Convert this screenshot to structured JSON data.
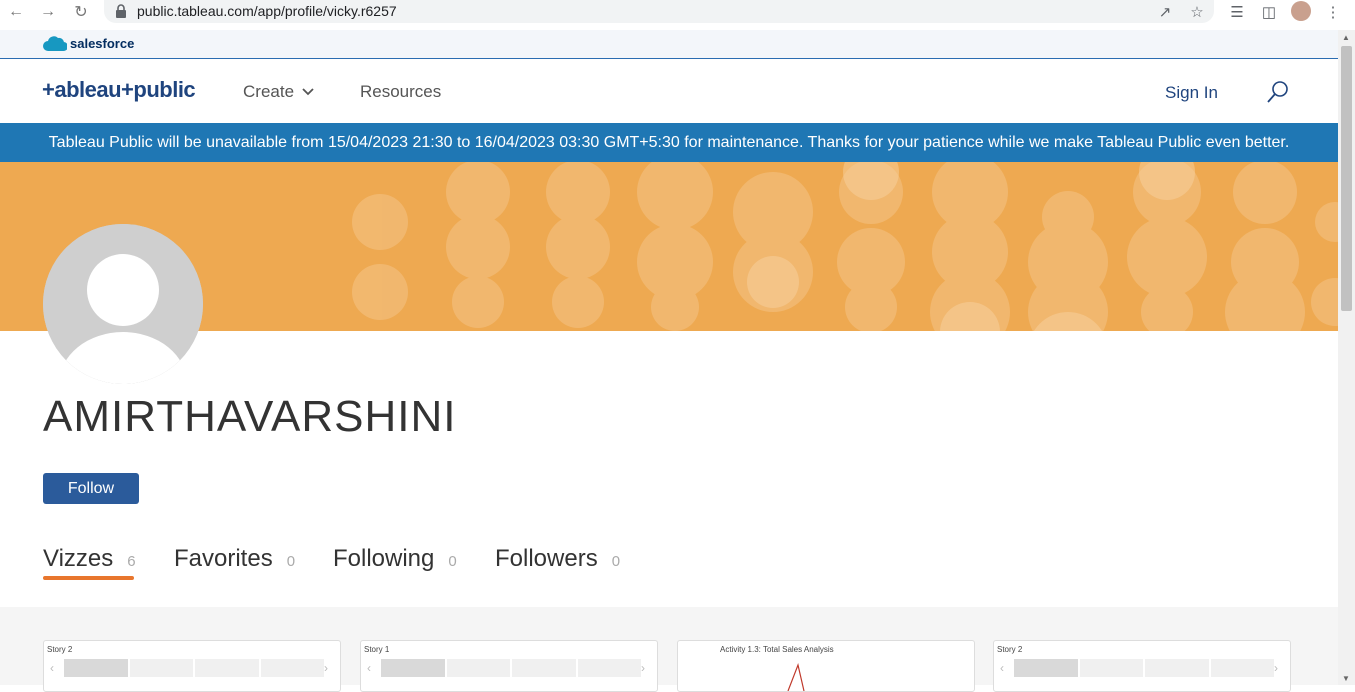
{
  "browser": {
    "url": "public.tableau.com/app/profile/vicky.r6257"
  },
  "salesforce": {
    "label": "salesforce"
  },
  "header": {
    "logo": "+ableau+public",
    "nav": {
      "create": "Create",
      "resources": "Resources"
    },
    "sign_in": "Sign In"
  },
  "banner": {
    "message": "Tableau Public will be unavailable from 15/04/2023 21:30 to 16/04/2023 03:30 GMT+5:30 for maintenance. Thanks for your patience while we make Tableau Public even better."
  },
  "profile": {
    "name": "AMIRTHAVARSHINI",
    "follow_label": "Follow"
  },
  "tabs": [
    {
      "label": "Vizzes",
      "count": "6"
    },
    {
      "label": "Favorites",
      "count": "0"
    },
    {
      "label": "Following",
      "count": "0"
    },
    {
      "label": "Followers",
      "count": "0"
    }
  ],
  "cards": [
    {
      "title": "Story 2"
    },
    {
      "title": "Story 1"
    },
    {
      "title": "Activity 1.3: Total Sales Analysis"
    },
    {
      "title": "Story 2"
    }
  ],
  "colors": {
    "banner": "#1f77b4",
    "cover": "#eea951",
    "follow": "#2b5b9b",
    "accent": "#e8762d",
    "brand": "#1f447e"
  }
}
